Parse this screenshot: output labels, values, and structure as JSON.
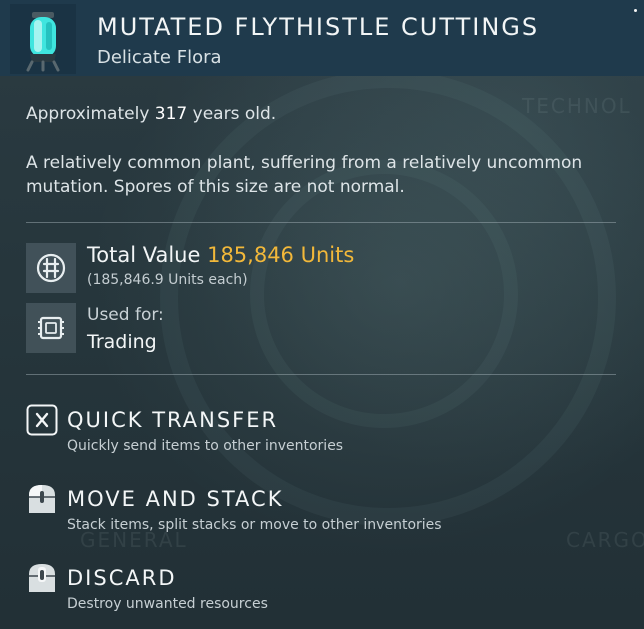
{
  "item": {
    "title": "MUTATED FLYTHISTLE CUTTINGS",
    "category": "Delicate Flora",
    "icon": "flora-capsule-icon"
  },
  "details": {
    "age_prefix": "Approximately",
    "age_value": "317",
    "age_suffix": "years old.",
    "description": "A relatively common plant, suffering from a relatively uncommon mutation. Spores of this size are not normal."
  },
  "value": {
    "label": "Total Value",
    "amount": "185,846 Units",
    "each": "(185,846.9 Units each)",
    "icon": "units-currency-icon",
    "accent_color": "#f2b83a"
  },
  "usage": {
    "label": "Used for:",
    "value": "Trading",
    "icon": "trading-chip-icon"
  },
  "actions": [
    {
      "title": "QUICK TRANSFER",
      "description": "Quickly send items to other inventories",
      "key": "X",
      "icon": "x-key-icon"
    },
    {
      "title": "MOVE AND STACK",
      "description": "Stack items, split stacks or move to other inventories",
      "icon": "left-mouse-button-icon"
    },
    {
      "title": "DISCARD",
      "description": "Destroy unwanted resources",
      "icon": "middle-mouse-button-icon"
    }
  ],
  "background_labels": {
    "top_right": "TECHNOL",
    "bottom_left": "GENERAL",
    "bottom_right": "CARGO"
  }
}
